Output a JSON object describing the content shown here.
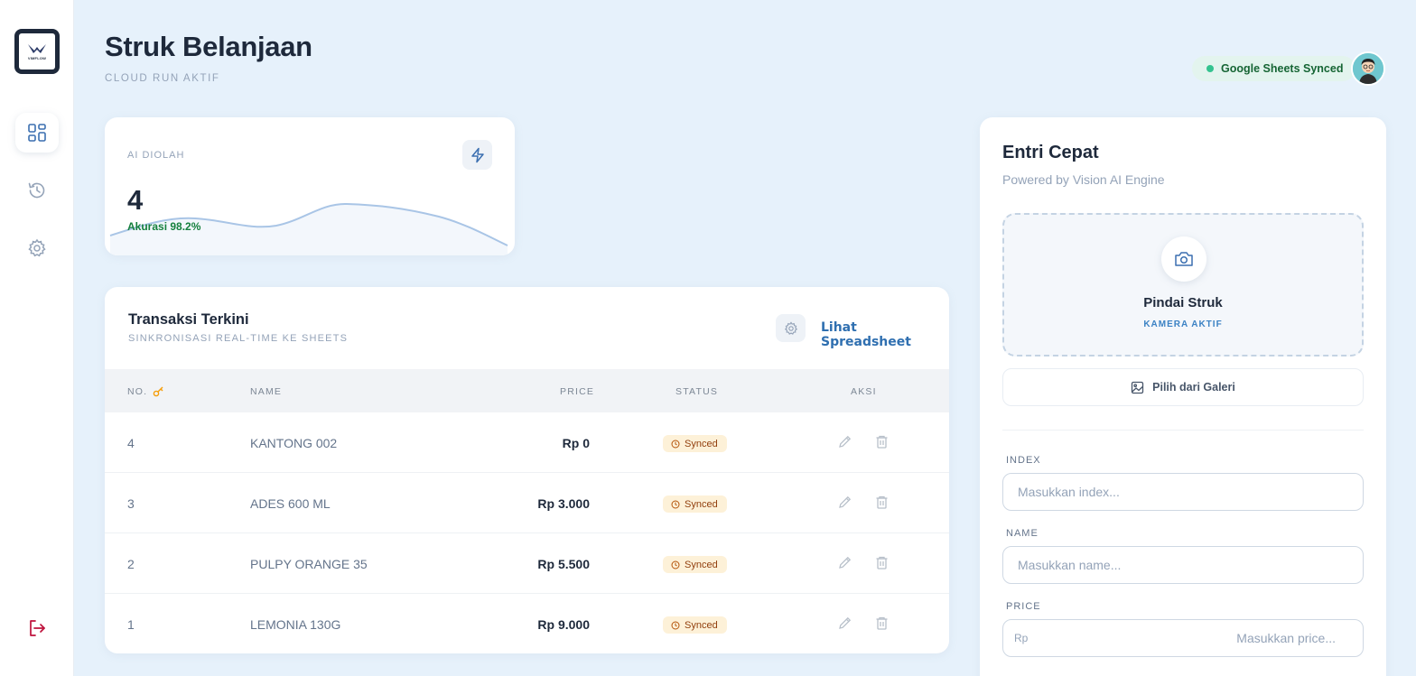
{
  "header": {
    "title": "Struk Belanjaan",
    "subtitle": "CLOUD RUN AKTIF",
    "sync_status": "Google Sheets Synced"
  },
  "sidebar": {
    "logo_text": "VIMFLOW",
    "items": [
      {
        "icon": "dashboard-icon",
        "active": true
      },
      {
        "icon": "history-icon",
        "active": false
      },
      {
        "icon": "gear-icon",
        "active": false
      }
    ],
    "logout_icon": "logout-icon"
  },
  "stats": {
    "label": "AI DIOLAH",
    "value": "4",
    "accuracy": "Akurasi 98.2%"
  },
  "transactions": {
    "title": "Transaksi Terkini",
    "subtitle": "SINKRONISASI REAL-TIME KE SHEETS",
    "link": "Lihat Spreadsheet",
    "columns": {
      "no": "NO.",
      "name": "NAME",
      "price": "PRICE",
      "status": "STATUS",
      "actions": "AKSI"
    },
    "rows": [
      {
        "no": "4",
        "name": "KANTONG 002",
        "price": "Rp 0",
        "status": "Synced"
      },
      {
        "no": "3",
        "name": "ADES 600 ML",
        "price": "Rp 3.000",
        "status": "Synced"
      },
      {
        "no": "2",
        "name": "PULPY ORANGE 35",
        "price": "Rp 5.500",
        "status": "Synced"
      },
      {
        "no": "1",
        "name": "LEMONIA 130G",
        "price": "Rp 9.000",
        "status": "Synced"
      }
    ]
  },
  "entry": {
    "title": "Entri Cepat",
    "subtitle": "Powered by Vision AI Engine",
    "scan_title": "Pindai Struk",
    "scan_sub": "KAMERA AKTIF",
    "gallery": "Pilih dari Galeri",
    "index_label": "INDEX",
    "index_placeholder": "Masukkan index...",
    "name_label": "NAME",
    "name_placeholder": "Masukkan name...",
    "price_label": "PRICE",
    "price_prefix": "Rp",
    "price_placeholder": "Masukkan price..."
  },
  "colors": {
    "background": "#e6f1fb",
    "accent": "#2f6fb0",
    "synced_badge": "#fdf1d8",
    "success": "#15803d",
    "logout": "#be123c"
  }
}
